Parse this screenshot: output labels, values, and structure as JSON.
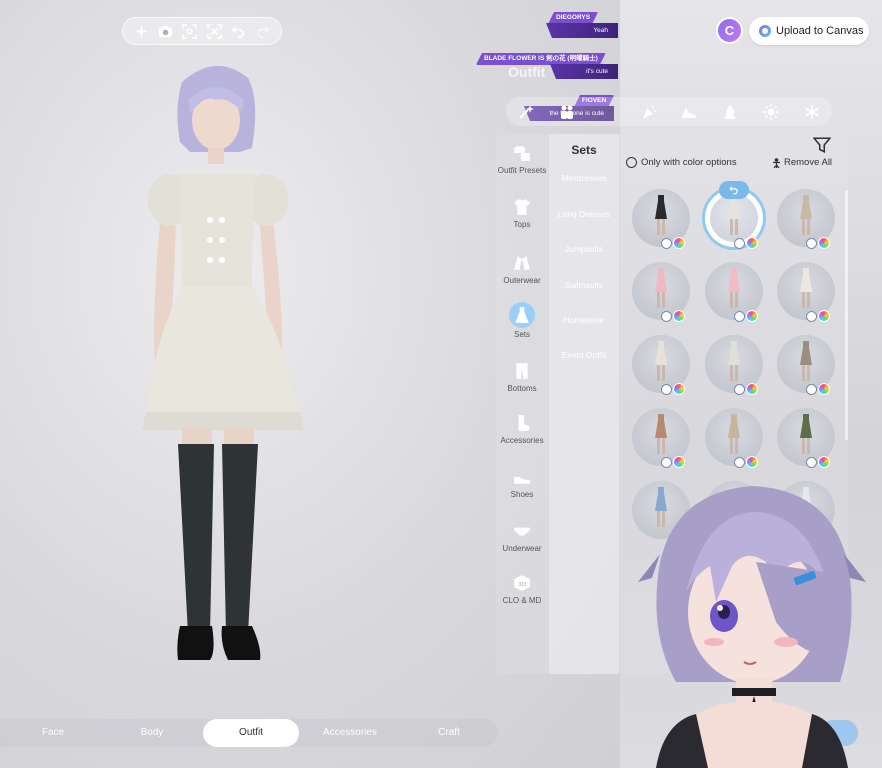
{
  "toolbar": {
    "icons": [
      "sparkle-icon",
      "camera-icon",
      "focus-icon",
      "scan-icon",
      "undo-icon",
      "redo-icon"
    ]
  },
  "chat": [
    {
      "user": "DIEGORYS",
      "message": "Yeah"
    },
    {
      "user": "BLADE FLOWER IS 剣の花 (明曜騎士)",
      "message": "it's cute"
    },
    {
      "user": "FIOVEN",
      "message": "the first one is cute"
    }
  ],
  "upload": {
    "logo": "C",
    "label": "Upload to Canvas"
  },
  "section_title": "Outfit",
  "style_strip": {
    "icons": [
      "magic-wand-icon",
      "people-icon",
      "moon-icon",
      "party-icon",
      "shoe-icon",
      "fire-icon",
      "sun-icon",
      "snowflake-icon"
    ]
  },
  "categories": [
    {
      "label": "Outfit Presets",
      "icon": "outfit-presets-icon"
    },
    {
      "label": "Tops",
      "icon": "tshirt-icon"
    },
    {
      "label": "Outerwear",
      "icon": "jacket-icon"
    },
    {
      "label": "Sets",
      "icon": "dress-icon",
      "active": true
    },
    {
      "label": "Bottoms",
      "icon": "pants-icon"
    },
    {
      "label": "Accessories",
      "icon": "sock-icon"
    },
    {
      "label": "Shoes",
      "icon": "shoe-icon"
    },
    {
      "label": "Underwear",
      "icon": "underwear-icon"
    },
    {
      "label": "CLO & MD",
      "icon": "clo-md-icon"
    }
  ],
  "sub": {
    "title": "Sets",
    "items": [
      "Minidresses",
      "Long Dresses",
      "Jumpsuits",
      "Swimsuits",
      "Homewear",
      "Event Outfit"
    ]
  },
  "filters": {
    "color_option_label": "Only with color options",
    "remove_all_label": "Remove All"
  },
  "items": [
    {
      "color": "#2a2a2e"
    },
    {
      "color": "#e6e2dc",
      "selected": true
    },
    {
      "color": "#c9b8a4"
    },
    {
      "color": "#efb8c2"
    },
    {
      "color": "#f0bdc5"
    },
    {
      "color": "#ece7e3"
    },
    {
      "color": "#e6e1d9"
    },
    {
      "color": "#e2ddd6"
    },
    {
      "color": "#9a8e7e"
    },
    {
      "color": "#b58a70"
    },
    {
      "color": "#c9b49c"
    },
    {
      "color": "#5e6e4a"
    },
    {
      "color": "#8aa7cf"
    },
    {
      "color": "#d6d6da"
    },
    {
      "color": "#e7e7ea"
    }
  ],
  "bottom_tabs": [
    {
      "label": "Face"
    },
    {
      "label": "Body"
    },
    {
      "label": "Outfit",
      "active": true
    },
    {
      "label": "Accessories"
    },
    {
      "label": "Craft"
    }
  ],
  "colors": {
    "accent": "#8ec9f2",
    "chat_purple": "#7b4fd0",
    "canvas_purple": "#8f6bf0"
  }
}
